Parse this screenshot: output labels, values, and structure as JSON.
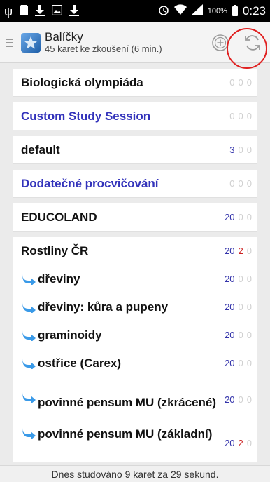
{
  "status_bar": {
    "battery": "100%",
    "time": "0:23",
    "icons": [
      "usb-icon",
      "sd-card-icon",
      "download-icon",
      "image-icon",
      "download-icon",
      "alarm-icon",
      "wifi-icon",
      "signal-icon",
      "battery-icon"
    ]
  },
  "action_bar": {
    "title": "Balíčky",
    "subtitle": "45 karet ke zkoušení (6 min.)",
    "icons": [
      "menu-icon",
      "app-logo",
      "add-icon",
      "sync-icon"
    ]
  },
  "decks": [
    {
      "name": "Biologická olympiáda",
      "filtered": false,
      "subdeck": false,
      "new": "0",
      "learn": "0",
      "review": "0"
    },
    {
      "name": "Custom Study Session",
      "filtered": true,
      "subdeck": false,
      "new": "0",
      "learn": "0",
      "review": "0"
    },
    {
      "name": "default",
      "filtered": false,
      "subdeck": false,
      "new": "3",
      "learn": "0",
      "review": "0"
    },
    {
      "name": "Dodatečné procvičování",
      "filtered": true,
      "subdeck": false,
      "new": "0",
      "learn": "0",
      "review": "0"
    },
    {
      "name": "EDUCOLAND",
      "filtered": false,
      "subdeck": false,
      "new": "20",
      "learn": "0",
      "review": "0"
    },
    {
      "name": "Rostliny ČR",
      "filtered": false,
      "subdeck": false,
      "new": "20",
      "learn": "2",
      "review": "0"
    },
    {
      "name": "dřeviny",
      "filtered": false,
      "subdeck": true,
      "new": "20",
      "learn": "0",
      "review": "0"
    },
    {
      "name": "dřeviny: kůra a pupeny",
      "filtered": false,
      "subdeck": true,
      "new": "20",
      "learn": "0",
      "review": "0"
    },
    {
      "name": "graminoidy",
      "filtered": false,
      "subdeck": true,
      "new": "20",
      "learn": "0",
      "review": "0"
    },
    {
      "name": "ostřice (Carex)",
      "filtered": false,
      "subdeck": true,
      "new": "20",
      "learn": "0",
      "review": "0"
    },
    {
      "name": "povinné pensum MU (zkrácené)",
      "filtered": false,
      "subdeck": true,
      "new": "20",
      "learn": "0",
      "review": "0"
    },
    {
      "name": "povinné pensum MU (základní)",
      "filtered": false,
      "subdeck": true,
      "new": "20",
      "learn": "2",
      "review": "0"
    }
  ],
  "footer": {
    "text": "Dnes studováno 9 karet za 29 sekund."
  },
  "colors": {
    "new": "#3333aa",
    "learn": "#cc2222",
    "zero": "#d0d0d0",
    "filtered": "#3333bb",
    "subdeck_arrow": "#3a9ae8",
    "highlight_circle": "#e02020"
  }
}
